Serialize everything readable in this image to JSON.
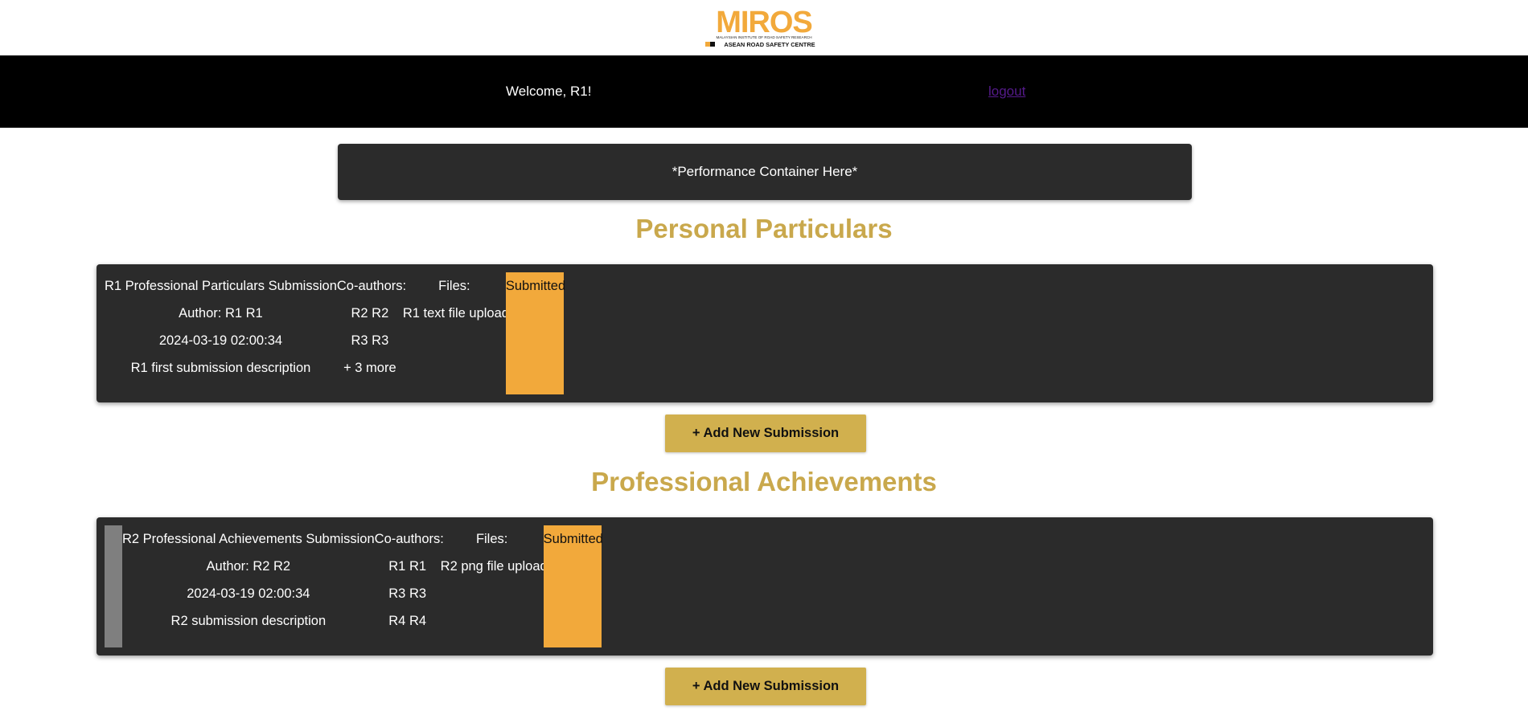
{
  "colors": {
    "accent": "#d1b04e",
    "title": "#c9a84c",
    "status": "#f2a93b",
    "card_bg": "#2b2b2b",
    "nav_bg": "#000000"
  },
  "logo": {
    "brand": "MIROS",
    "line1": "MALAYSIAN INSTITUTE OF ROAD SAFETY RESEARCH",
    "line2": "ASEAN ROAD SAFETY CENTRE"
  },
  "nav": {
    "welcome": "Welcome, R1!",
    "logout": "logout"
  },
  "performance": {
    "text": "*Performance Container Here*"
  },
  "sections": [
    {
      "title": "Personal Particulars",
      "submission": {
        "title": "R1 Professional Particulars Submission",
        "author": "Author: R1 R1",
        "date": "2024-03-19 02:00:34",
        "description": "R1 first submission description",
        "coauthors_label": "Co-authors:",
        "coauthors": [
          "R2 R2",
          "R3 R3",
          "+ 3 more"
        ],
        "files_label": "Files:",
        "files": [
          "R1 text file upload"
        ],
        "status": "Submitted"
      },
      "add_button": "+ Add New Submission"
    },
    {
      "title": "Professional Achievements",
      "submission": {
        "title": "R2 Professional Achievements Submission",
        "author": "Author: R2 R2",
        "date": "2024-03-19 02:00:34",
        "description": "R2 submission description",
        "coauthors_label": "Co-authors:",
        "coauthors": [
          "R1 R1",
          "R3 R3",
          "R4 R4"
        ],
        "files_label": "Files:",
        "files": [
          "R2 png file upload"
        ],
        "status": "Submitted"
      },
      "add_button": "+ Add New Submission"
    }
  ]
}
